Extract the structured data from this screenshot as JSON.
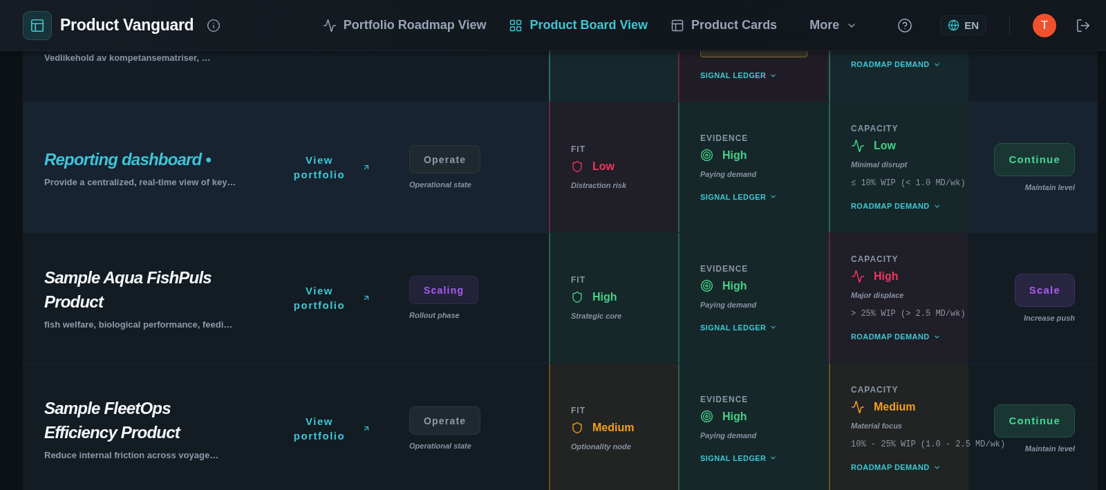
{
  "header": {
    "title": "Product Vanguard",
    "nav": [
      {
        "label": "Portfolio Roadmap View",
        "kind": "roadmap",
        "selected": false
      },
      {
        "label": "Product Board View",
        "kind": "board",
        "selected": true
      },
      {
        "label": "Product Cards",
        "kind": "cards",
        "selected": false
      }
    ],
    "more": "More",
    "language": "EN",
    "avatar": "T"
  },
  "partial_row": {
    "description": "Vedlikehold av kompetansematriser, …",
    "fit": {
      "color": "#2c6b5d"
    },
    "evidence": {
      "color": "#6b2539",
      "badge": {
        "color": "#8c6b3a"
      },
      "link": "SIGNAL LEDGER"
    },
    "capacity": {
      "color": "#2c6b5d",
      "link": "ROADMAP DEMAND"
    }
  },
  "rows": [
    {
      "title": "Reporting dashboard •",
      "selected": true,
      "description": "Provide a centralized, real-time view of key…",
      "link": "View portfolio",
      "phase": {
        "label": "Operate",
        "color": "#8e99a8",
        "caption": "Operational state"
      },
      "fit": {
        "heading": "FIT",
        "value": "Low",
        "color": "#f2355f",
        "caption": "Distraction risk"
      },
      "evidence": {
        "heading": "EVIDENCE",
        "value": "High",
        "color": "#45d08a",
        "caption": "Paying demand",
        "link": "SIGNAL LEDGER"
      },
      "capacity": {
        "heading": "CAPACITY",
        "value": "Low",
        "color": "#45d08a",
        "caption": "Minimal disrupt",
        "range": "≤ 10% WIP (< 1.0 MD/wk)",
        "link": "ROADMAP DEMAND"
      },
      "action": {
        "label": "Continue",
        "color": "#45d494",
        "caption": "Maintain level"
      }
    },
    {
      "title": "Sample Aqua FishPuls Product",
      "selected": false,
      "description": "fish welfare, biological performance, feedi…",
      "link": "View portfolio",
      "phase": {
        "label": "Scaling",
        "color": "#a85cf0",
        "caption": "Rollout phase"
      },
      "fit": {
        "heading": "FIT",
        "value": "High",
        "color": "#45d08a",
        "caption": "Strategic core"
      },
      "evidence": {
        "heading": "EVIDENCE",
        "value": "High",
        "color": "#45d08a",
        "caption": "Paying demand",
        "link": "SIGNAL LEDGER"
      },
      "capacity": {
        "heading": "CAPACITY",
        "value": "High",
        "color": "#f2355f",
        "caption": "Major displace",
        "range": "> 25% WIP (> 2.5 MD/wk)",
        "link": "ROADMAP DEMAND"
      },
      "action": {
        "label": "Scale",
        "color": "#a85cf0",
        "caption": "Increase push"
      }
    },
    {
      "title": "Sample FleetOps Efficiency Product",
      "selected": false,
      "description": "Reduce internal friction across voyage…",
      "link": "View portfolio",
      "phase": {
        "label": "Operate",
        "color": "#8e99a8",
        "caption": "Operational state"
      },
      "fit": {
        "heading": "FIT",
        "value": "Medium",
        "color": "#f59e1c",
        "caption": "Optionality node"
      },
      "evidence": {
        "heading": "EVIDENCE",
        "value": "High",
        "color": "#45d08a",
        "caption": "Paying demand",
        "link": "SIGNAL LEDGER"
      },
      "capacity": {
        "heading": "CAPACITY",
        "value": "Medium",
        "color": "#f59e1c",
        "caption": "Material focus",
        "range": "10% - 25% WIP (1.0 - 2.5 MD/wk)",
        "link": "ROADMAP DEMAND"
      },
      "action": {
        "label": "Continue",
        "color": "#45d494",
        "caption": "Maintain level"
      }
    }
  ]
}
